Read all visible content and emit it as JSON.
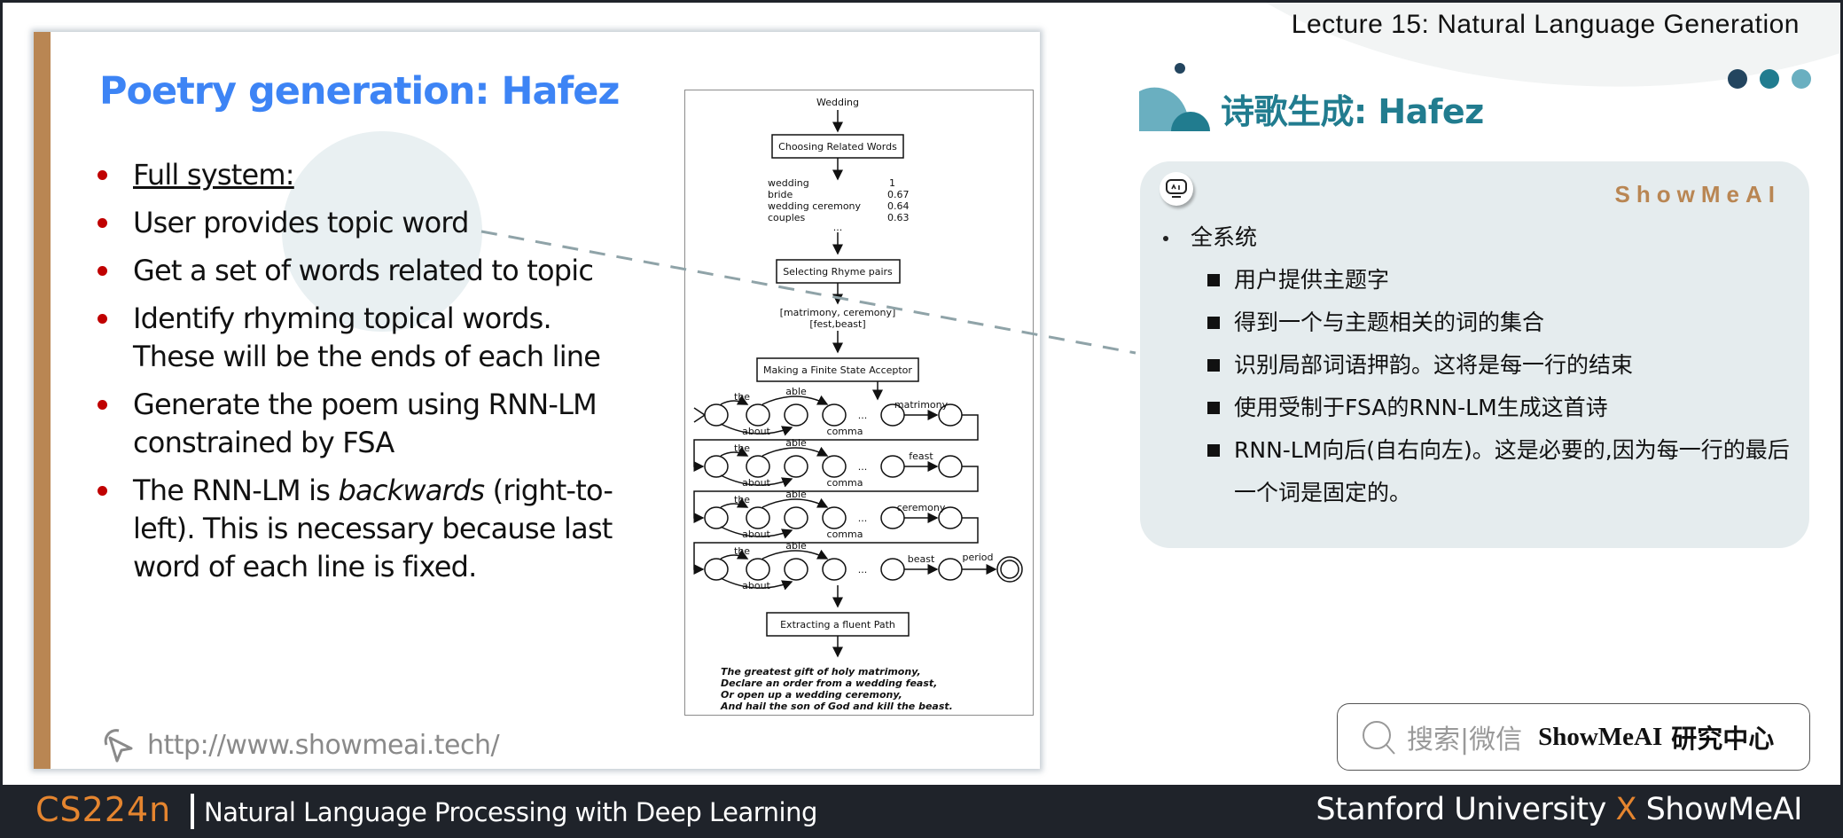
{
  "colors": {
    "accent_blue": "#3d84f5",
    "bullet_red": "#c00000",
    "slide_bar": "#b98653",
    "teal_dark": "#23455f",
    "teal_mid": "#217c8f",
    "teal_light": "#6aafc0",
    "brand_orange": "#b98653",
    "course_orange": "#e5852f",
    "dashed_line": "#8fa3a8"
  },
  "header": {
    "lecture_title": "Lecture 15: Natural Language Generation"
  },
  "slide": {
    "title": "Poetry generation: Hafez",
    "bullets": [
      {
        "text": "Full system:",
        "underline": true
      },
      {
        "text": "User provides topic word"
      },
      {
        "text": "Get a set of words related to topic"
      },
      {
        "line1": "Identify rhyming topical words.",
        "line2": "These will be the ends of each line"
      },
      {
        "line1": "Generate the poem using RNN-LM",
        "line2": "constrained by FSA"
      },
      {
        "pre": "The RNN-LM is ",
        "italic": "backwards",
        "post": " (right-to-",
        "line2": "left). This is necessary because last",
        "line3": "word of each line is fixed."
      }
    ],
    "url": "http://www.showmeai.tech/",
    "url_icon": "cursor-click-icon"
  },
  "figure": {
    "start": "Wedding",
    "step1": "Choosing Related Words",
    "related_words": [
      {
        "word": "wedding",
        "score": "1"
      },
      {
        "word": "bride",
        "score": "0.67"
      },
      {
        "word": "wedding ceremony",
        "score": "0.64"
      },
      {
        "word": "couples",
        "score": "0.63"
      }
    ],
    "ellipsis": "...",
    "step2": "Selecting Rhyme pairs",
    "rhyme_pair_1": "[matrimony, ceremony]",
    "rhyme_pair_2": "[fest,beast]",
    "step3": "Making a Finite State Acceptor",
    "fsa_rows": [
      {
        "end_word": "matrimony",
        "extra": ""
      },
      {
        "end_word": "feast",
        "extra": ""
      },
      {
        "end_word": "ceremony",
        "extra": ""
      },
      {
        "end_word": "beast",
        "extra": "period"
      }
    ],
    "fsa_labels": {
      "the": "the",
      "able": "able",
      "about": "about",
      "comma": "comma"
    },
    "step4": "Extracting a fluent Path",
    "poem": [
      "The greatest gift of holy matrimony,",
      "Declare an order from a wedding feast,",
      "Or open up a wedding ceremony,",
      "And hail the son of God and kill the beast."
    ]
  },
  "zh": {
    "title": "诗歌生成: Hafez",
    "brand": "ShowMeAI",
    "robot_icon": "robot-ai-icon",
    "items": [
      {
        "level": 1,
        "text": "全系统"
      },
      {
        "level": 2,
        "text": "用户提供主题字"
      },
      {
        "level": 2,
        "text": "得到一个与主题相关的词的集合"
      },
      {
        "level": 2,
        "text": "识别局部词语押韵。这将是每一行的结束"
      },
      {
        "level": 2,
        "text": "使用受制于FSA的RNN-LM生成这首诗"
      },
      {
        "level": 2,
        "text": "RNN-LM向后(自右向左)。这是必要的,因为每一行的最后一个词是固定的。"
      }
    ]
  },
  "search": {
    "hint": "搜索|微信",
    "brand": "ShowMeAI",
    "brand_zh": "研究中心"
  },
  "footer": {
    "course_code": "CS224n",
    "course_name": "Natural Language Processing with Deep Learning",
    "credit_left": "Stanford University",
    "credit_x": "X",
    "credit_right": "ShowMeAI"
  }
}
